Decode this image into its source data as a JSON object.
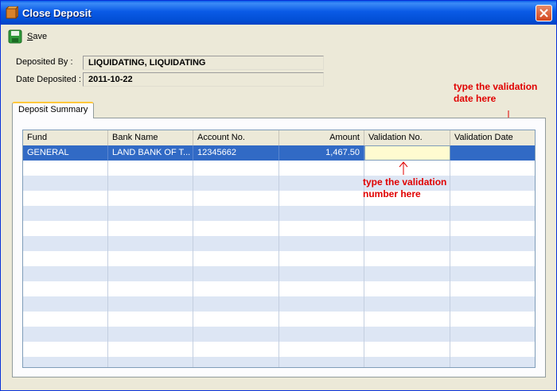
{
  "window": {
    "title": "Close Deposit"
  },
  "toolbar": {
    "save_label_first": "S",
    "save_label_rest": "ave"
  },
  "form": {
    "deposited_by_label": "Deposited By :",
    "deposited_by_value": "LIQUIDATING, LIQUIDATING",
    "date_deposited_label": "Date Deposited :",
    "date_deposited_value": "2011-10-22"
  },
  "tab": {
    "label": "Deposit Summary"
  },
  "grid": {
    "columns": [
      "Fund",
      "Bank Name",
      "Account No.",
      "Amount",
      "Validation No.",
      "Validation Date"
    ],
    "rows": [
      {
        "fund": "GENERAL",
        "bank_name": "LAND BANK OF T...",
        "account_no": "12345662",
        "amount": "1,467.50",
        "validation_no": "",
        "validation_date": ""
      }
    ]
  },
  "annotations": {
    "validation_date_hint": "type the validation date here",
    "validation_no_hint": "type the validation number here"
  },
  "colors": {
    "selection": "#316ac5",
    "annotation": "#e00000",
    "titlebar": "#0a5ae6"
  }
}
